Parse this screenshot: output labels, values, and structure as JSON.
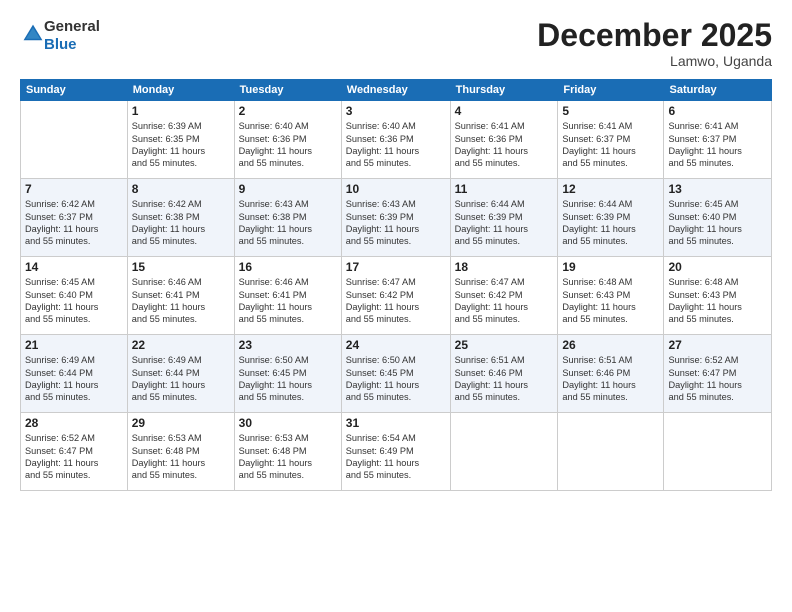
{
  "logo": {
    "general": "General",
    "blue": "Blue"
  },
  "header": {
    "month": "December 2025",
    "location": "Lamwo, Uganda"
  },
  "weekdays": [
    "Sunday",
    "Monday",
    "Tuesday",
    "Wednesday",
    "Thursday",
    "Friday",
    "Saturday"
  ],
  "weeks": [
    [
      {
        "day": "",
        "info": ""
      },
      {
        "day": "1",
        "info": "Sunrise: 6:39 AM\nSunset: 6:35 PM\nDaylight: 11 hours\nand 55 minutes."
      },
      {
        "day": "2",
        "info": "Sunrise: 6:40 AM\nSunset: 6:36 PM\nDaylight: 11 hours\nand 55 minutes."
      },
      {
        "day": "3",
        "info": "Sunrise: 6:40 AM\nSunset: 6:36 PM\nDaylight: 11 hours\nand 55 minutes."
      },
      {
        "day": "4",
        "info": "Sunrise: 6:41 AM\nSunset: 6:36 PM\nDaylight: 11 hours\nand 55 minutes."
      },
      {
        "day": "5",
        "info": "Sunrise: 6:41 AM\nSunset: 6:37 PM\nDaylight: 11 hours\nand 55 minutes."
      },
      {
        "day": "6",
        "info": "Sunrise: 6:41 AM\nSunset: 6:37 PM\nDaylight: 11 hours\nand 55 minutes."
      }
    ],
    [
      {
        "day": "7",
        "info": "Sunrise: 6:42 AM\nSunset: 6:37 PM\nDaylight: 11 hours\nand 55 minutes."
      },
      {
        "day": "8",
        "info": "Sunrise: 6:42 AM\nSunset: 6:38 PM\nDaylight: 11 hours\nand 55 minutes."
      },
      {
        "day": "9",
        "info": "Sunrise: 6:43 AM\nSunset: 6:38 PM\nDaylight: 11 hours\nand 55 minutes."
      },
      {
        "day": "10",
        "info": "Sunrise: 6:43 AM\nSunset: 6:39 PM\nDaylight: 11 hours\nand 55 minutes."
      },
      {
        "day": "11",
        "info": "Sunrise: 6:44 AM\nSunset: 6:39 PM\nDaylight: 11 hours\nand 55 minutes."
      },
      {
        "day": "12",
        "info": "Sunrise: 6:44 AM\nSunset: 6:39 PM\nDaylight: 11 hours\nand 55 minutes."
      },
      {
        "day": "13",
        "info": "Sunrise: 6:45 AM\nSunset: 6:40 PM\nDaylight: 11 hours\nand 55 minutes."
      }
    ],
    [
      {
        "day": "14",
        "info": "Sunrise: 6:45 AM\nSunset: 6:40 PM\nDaylight: 11 hours\nand 55 minutes."
      },
      {
        "day": "15",
        "info": "Sunrise: 6:46 AM\nSunset: 6:41 PM\nDaylight: 11 hours\nand 55 minutes."
      },
      {
        "day": "16",
        "info": "Sunrise: 6:46 AM\nSunset: 6:41 PM\nDaylight: 11 hours\nand 55 minutes."
      },
      {
        "day": "17",
        "info": "Sunrise: 6:47 AM\nSunset: 6:42 PM\nDaylight: 11 hours\nand 55 minutes."
      },
      {
        "day": "18",
        "info": "Sunrise: 6:47 AM\nSunset: 6:42 PM\nDaylight: 11 hours\nand 55 minutes."
      },
      {
        "day": "19",
        "info": "Sunrise: 6:48 AM\nSunset: 6:43 PM\nDaylight: 11 hours\nand 55 minutes."
      },
      {
        "day": "20",
        "info": "Sunrise: 6:48 AM\nSunset: 6:43 PM\nDaylight: 11 hours\nand 55 minutes."
      }
    ],
    [
      {
        "day": "21",
        "info": "Sunrise: 6:49 AM\nSunset: 6:44 PM\nDaylight: 11 hours\nand 55 minutes."
      },
      {
        "day": "22",
        "info": "Sunrise: 6:49 AM\nSunset: 6:44 PM\nDaylight: 11 hours\nand 55 minutes."
      },
      {
        "day": "23",
        "info": "Sunrise: 6:50 AM\nSunset: 6:45 PM\nDaylight: 11 hours\nand 55 minutes."
      },
      {
        "day": "24",
        "info": "Sunrise: 6:50 AM\nSunset: 6:45 PM\nDaylight: 11 hours\nand 55 minutes."
      },
      {
        "day": "25",
        "info": "Sunrise: 6:51 AM\nSunset: 6:46 PM\nDaylight: 11 hours\nand 55 minutes."
      },
      {
        "day": "26",
        "info": "Sunrise: 6:51 AM\nSunset: 6:46 PM\nDaylight: 11 hours\nand 55 minutes."
      },
      {
        "day": "27",
        "info": "Sunrise: 6:52 AM\nSunset: 6:47 PM\nDaylight: 11 hours\nand 55 minutes."
      }
    ],
    [
      {
        "day": "28",
        "info": "Sunrise: 6:52 AM\nSunset: 6:47 PM\nDaylight: 11 hours\nand 55 minutes."
      },
      {
        "day": "29",
        "info": "Sunrise: 6:53 AM\nSunset: 6:48 PM\nDaylight: 11 hours\nand 55 minutes."
      },
      {
        "day": "30",
        "info": "Sunrise: 6:53 AM\nSunset: 6:48 PM\nDaylight: 11 hours\nand 55 minutes."
      },
      {
        "day": "31",
        "info": "Sunrise: 6:54 AM\nSunset: 6:49 PM\nDaylight: 11 hours\nand 55 minutes."
      },
      {
        "day": "",
        "info": ""
      },
      {
        "day": "",
        "info": ""
      },
      {
        "day": "",
        "info": ""
      }
    ]
  ]
}
